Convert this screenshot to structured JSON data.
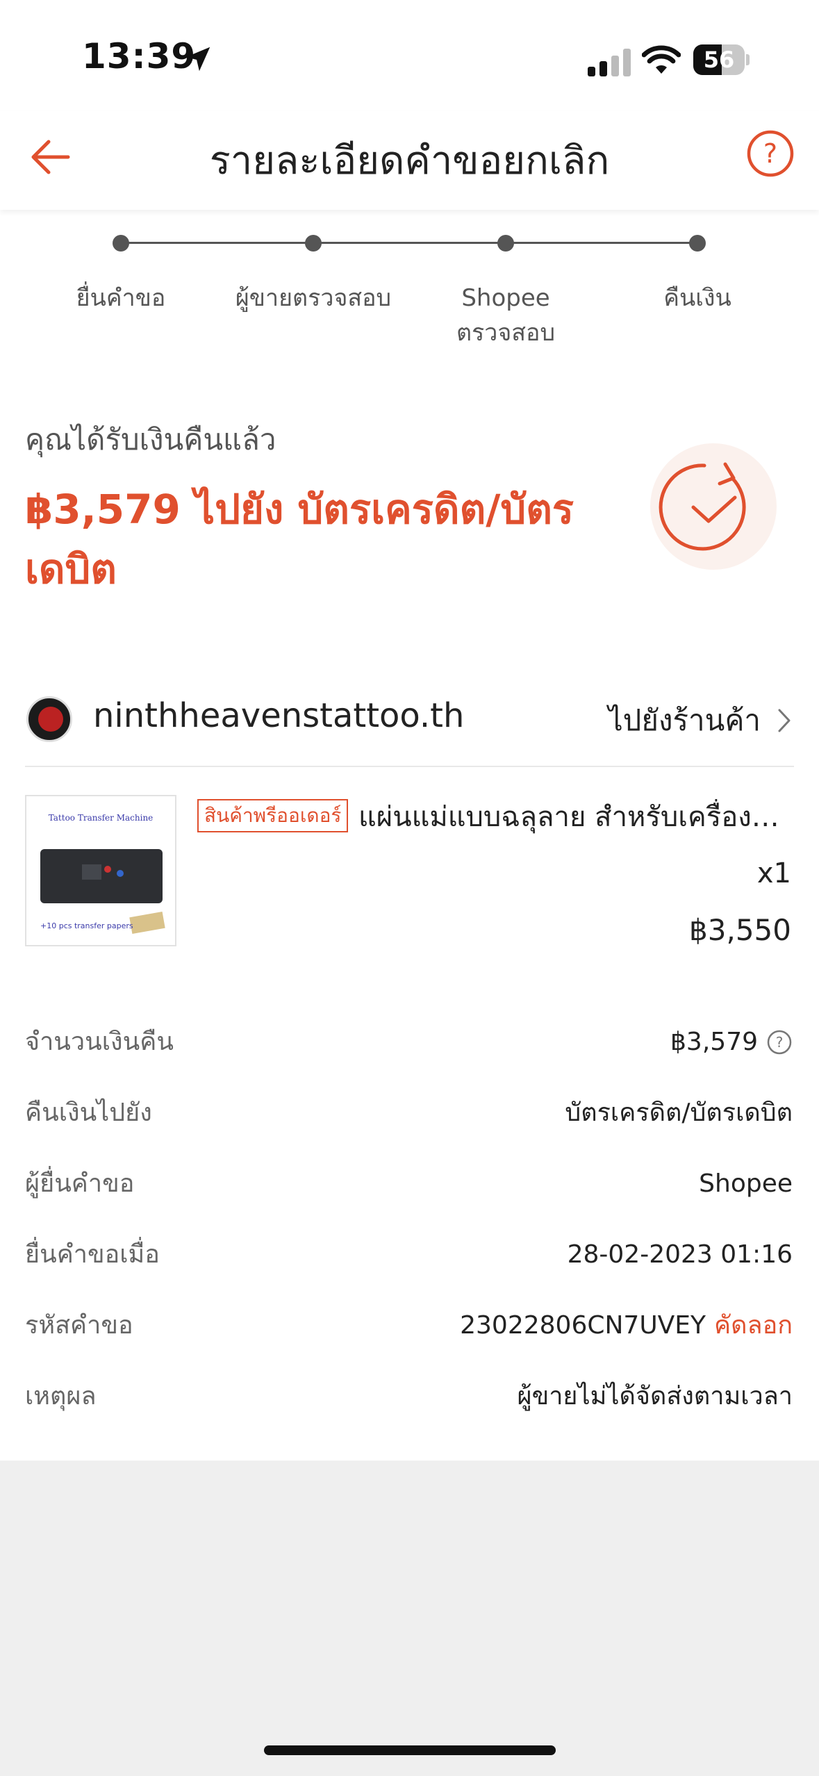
{
  "status_bar": {
    "time": "13:39",
    "battery": "56",
    "battery_level": 0.56
  },
  "header": {
    "title": "รายละเอียดคำขอยกเลิก"
  },
  "stepper": {
    "steps": [
      {
        "label": "ยื่นคำขอ"
      },
      {
        "label": "ผู้ขายตรวจสอบ"
      },
      {
        "label": "Shopee ตรวจสอบ"
      },
      {
        "label": "คืนเงิน"
      }
    ]
  },
  "refund": {
    "heading": "คุณได้รับเงินคืนแล้ว",
    "amount_text": "฿3,579 ไปยัง บัตรเครดิต/บัตรเดบิต"
  },
  "shop": {
    "name": "ninthheavenstattoo.th",
    "link_label": "ไปยังร้านค้า"
  },
  "product": {
    "thumb_title": "Tattoo Transfer Machine",
    "thumb_caption": "+10 pcs transfer papers",
    "badge": "สินค้าพรีออเดอร์",
    "name": "แผ่นแม่แบบฉลุลาย สำหรับเครื่องทำลายสักแบบพกพา",
    "qty": "x1",
    "price": "฿3,550"
  },
  "details": [
    {
      "label": "จำนวนเงินคืน",
      "value": "฿3,579"
    },
    {
      "label": "คืนเงินไปยัง",
      "value": "บัตรเครดิต/บัตรเดบิต"
    },
    {
      "label": "ผู้ยื่นคำขอ",
      "value": "Shopee"
    },
    {
      "label": "ยื่นคำขอเมื่อ",
      "value": "28-02-2023 01:16"
    },
    {
      "label": "รหัสคำขอ",
      "value": "23022806CN7UVEY",
      "action": "คัดลอก"
    },
    {
      "label": "เหตุผล",
      "value": "ผู้ขายไม่ได้จัดส่งตามเวลา"
    }
  ],
  "colors": {
    "accent": "#e0502e",
    "text": "#222222",
    "muted": "#666666",
    "background": "#efefef"
  },
  "icons": {
    "back": "arrow-left-icon",
    "help": "question-circle-icon",
    "refund_done": "refresh-check-icon",
    "shop_link": "chevron-right-icon",
    "refund_info": "question-circle-icon"
  }
}
